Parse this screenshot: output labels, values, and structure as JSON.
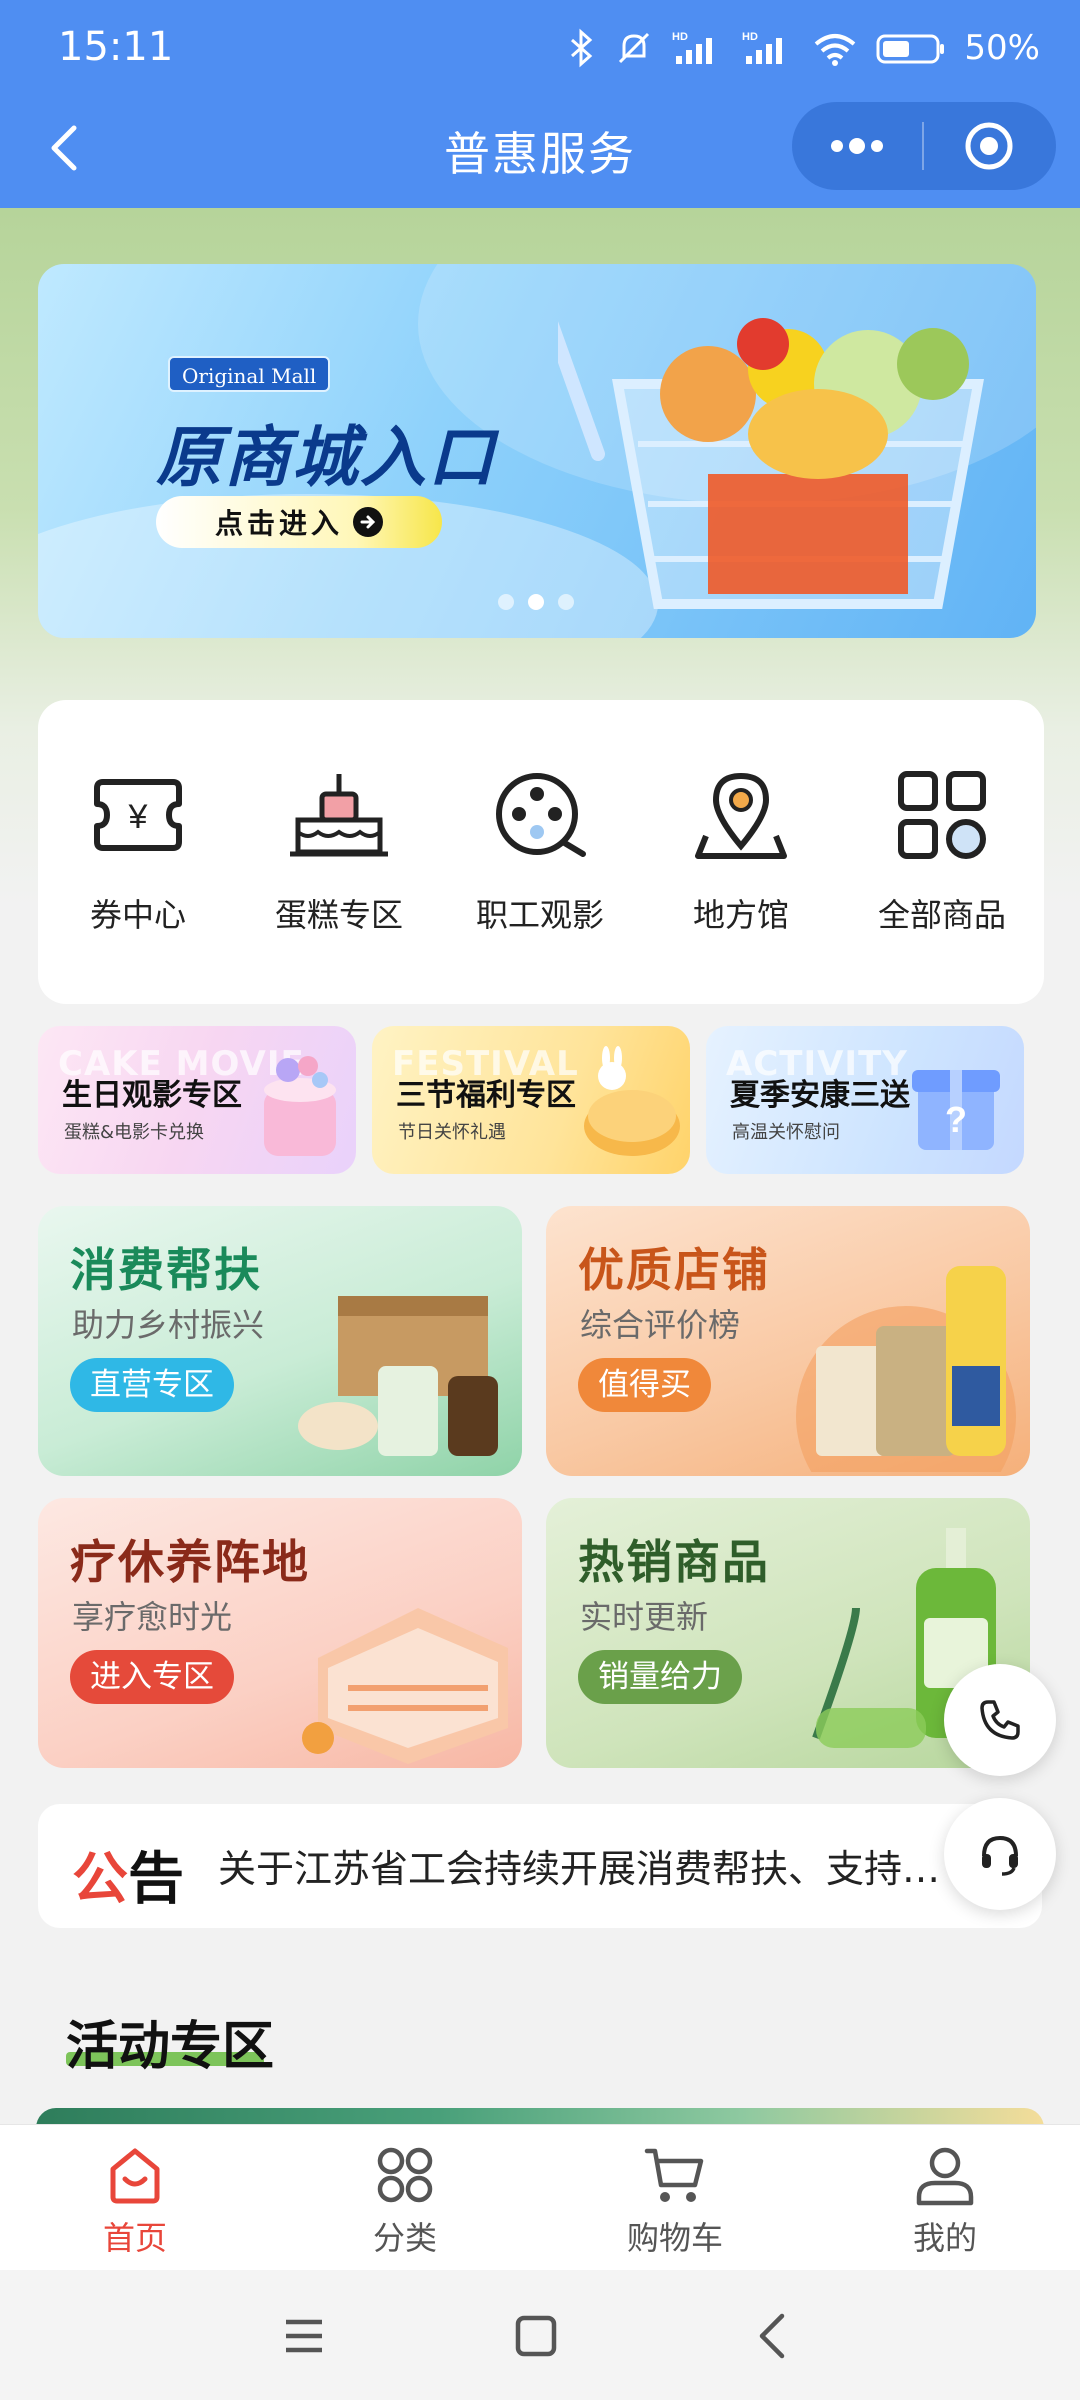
{
  "status_bar": {
    "time": "15:11",
    "battery": "50%"
  },
  "nav": {
    "title": "普惠服务"
  },
  "banner": {
    "tag": "Original Mall",
    "title": "原商城入口",
    "button": "点击进入",
    "slides": 3,
    "active_slide": 2
  },
  "grid": {
    "items": [
      {
        "label": "券中心",
        "icon": "ticket-icon"
      },
      {
        "label": "蛋糕专区",
        "icon": "cake-icon"
      },
      {
        "label": "职工观影",
        "icon": "film-reel-icon"
      },
      {
        "label": "地方馆",
        "icon": "map-pin-icon"
      },
      {
        "label": "全部商品",
        "icon": "all-products-icon"
      }
    ]
  },
  "promos": [
    {
      "ghost": "CAKE MOVIE",
      "title": "生日观影专区",
      "subtitle": "蛋糕&电影卡兑换"
    },
    {
      "ghost": "FESTIVAL",
      "title": "三节福利专区",
      "subtitle": "节日关怀礼遇"
    },
    {
      "ghost": "ACTIVITY",
      "title": "夏季安康三送",
      "subtitle": "高温关怀慰问"
    }
  ],
  "tiles": [
    {
      "title": "消费帮扶",
      "subtitle": "助力乡村振兴",
      "button": "直营专区",
      "color": "#1a8a5a",
      "btn_color": "#2fb8e6"
    },
    {
      "title": "优质店铺",
      "subtitle": "综合评价榜",
      "button": "值得买",
      "color": "#c8551a",
      "btn_color": "#f0883a"
    },
    {
      "title": "疗休养阵地",
      "subtitle": "享疗愈时光",
      "button": "进入专区",
      "color": "#8a2a1a",
      "btn_color": "#e54a3a"
    },
    {
      "title": "热销商品",
      "subtitle": "实时更新",
      "button": "销量给力",
      "color": "#2f5e2a",
      "btn_color": "#6aa04a"
    }
  ],
  "notice": {
    "label_red": "公",
    "label_black": "告",
    "text": "关于江苏省工会持续开展消费帮扶、支持地方经济"
  },
  "section": {
    "title": "活动专区"
  },
  "tabbar": {
    "tabs": [
      {
        "label": "首页",
        "icon": "home-icon",
        "active": true
      },
      {
        "label": "分类",
        "icon": "category-icon",
        "active": false
      },
      {
        "label": "购物车",
        "icon": "cart-icon",
        "active": false
      },
      {
        "label": "我的",
        "icon": "user-icon",
        "active": false
      }
    ]
  },
  "colors": {
    "header": "#4f8ef2",
    "accent": "#e8463a"
  }
}
